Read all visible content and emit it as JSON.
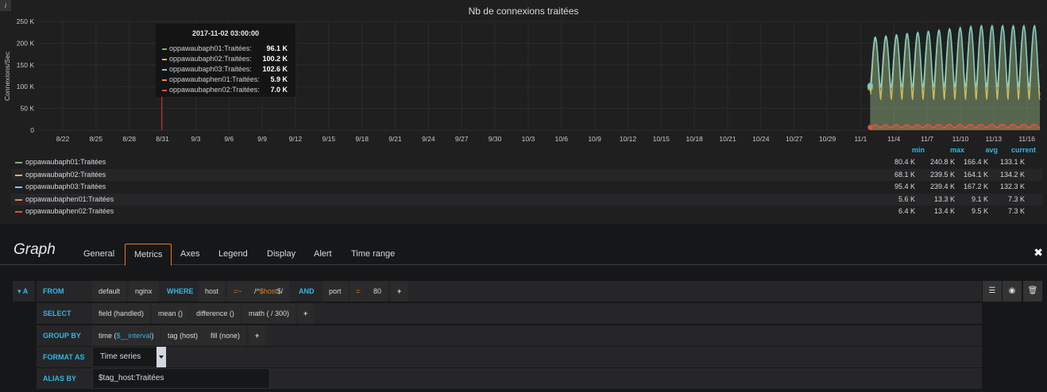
{
  "panel": {
    "info_icon": "i",
    "title": "Nb de connexions traitées"
  },
  "tooltip": {
    "time": "2017-11-02 03:00:00",
    "rows": [
      {
        "name": "oppawaubaph01:Traitées:",
        "value": "96.1 K",
        "color": "#7eb26d"
      },
      {
        "name": "oppawaubaph02:Traitées:",
        "value": "100.2 K",
        "color": "#eab839"
      },
      {
        "name": "oppawaubaph03:Traitées:",
        "value": "102.6 K",
        "color": "#6ed0e0"
      },
      {
        "name": "oppawaubaphen01:Traitées:",
        "value": "5.9 K",
        "color": "#ef843c"
      },
      {
        "name": "oppawaubaphen02:Traitées:",
        "value": "7.0 K",
        "color": "#e24d42"
      }
    ]
  },
  "legend": {
    "headers": [
      "min",
      "max",
      "avg",
      "current"
    ],
    "rows": [
      {
        "name": "oppawaubaph01:Traitées",
        "color": "#7eb26d",
        "min": "80.4 K",
        "max": "240.8 K",
        "avg": "166.4 K",
        "current": "133.1 K"
      },
      {
        "name": "oppawaubaph02:Traitées",
        "color": "#eab839",
        "min": "68.1 K",
        "max": "239.5 K",
        "avg": "164.1 K",
        "current": "134.2 K"
      },
      {
        "name": "oppawaubaph03:Traitées",
        "color": "#6ed0e0",
        "min": "95.4 K",
        "max": "239.4 K",
        "avg": "167.2 K",
        "current": "132.3 K"
      },
      {
        "name": "oppawaubaphen01:Traitées",
        "color": "#ef843c",
        "min": "5.6 K",
        "max": "13.3 K",
        "avg": "9.1 K",
        "current": "7.3 K"
      },
      {
        "name": "oppawaubaphen02:Traitées",
        "color": "#e24d42",
        "min": "6.4 K",
        "max": "13.4 K",
        "avg": "9.5 K",
        "current": "7.3 K"
      }
    ]
  },
  "chart_data": {
    "type": "area",
    "ylabel": "Connexions/Sec",
    "ylim": [
      0,
      250000
    ],
    "y_ticks": [
      "0",
      "50 K",
      "100 K",
      "150 K",
      "200 K",
      "250 K"
    ],
    "x_ticks": [
      "8/22",
      "8/25",
      "8/28",
      "8/31",
      "9/3",
      "9/6",
      "9/9",
      "9/12",
      "9/15",
      "9/18",
      "9/21",
      "9/24",
      "9/27",
      "9/30",
      "10/3",
      "10/6",
      "10/9",
      "10/12",
      "10/15",
      "10/18",
      "10/21",
      "10/24",
      "10/27",
      "10/29",
      "11/1",
      "11/4",
      "11/7",
      "11/10",
      "11/13",
      "11/16"
    ],
    "grid": true,
    "hover_marker_date": "8/31",
    "data_start_date": "11/1",
    "series": [
      {
        "name": "oppawaubaph01:Traitées",
        "color": "#7eb26d",
        "low": 80400,
        "high": 240800,
        "start": 96100
      },
      {
        "name": "oppawaubaph02:Traitées",
        "color": "#eab839",
        "low": 68100,
        "high": 239500,
        "start": 100200
      },
      {
        "name": "oppawaubaph03:Traitées",
        "color": "#6ed0e0",
        "low": 95400,
        "high": 239400,
        "start": 102600
      },
      {
        "name": "oppawaubaphen01:Traitées",
        "color": "#ef843c",
        "low": 5600,
        "high": 13300,
        "start": 5900
      },
      {
        "name": "oppawaubaphen02:Traitées",
        "color": "#e24d42",
        "low": 6400,
        "high": 13400,
        "start": 7000
      }
    ]
  },
  "editor": {
    "title": "Graph",
    "tabs": [
      "General",
      "Metrics",
      "Axes",
      "Legend",
      "Display",
      "Alert",
      "Time range"
    ],
    "active_tab": "Metrics",
    "close_label": "✖"
  },
  "query": {
    "ref": "A",
    "from": {
      "keyword": "FROM",
      "policy": "default",
      "measurement": "nginx",
      "where": "WHERE",
      "tag1": "host",
      "op1": "=~",
      "val1_pre": "/^",
      "val1_var": "$host",
      "val1_post": "$/",
      "and": "AND",
      "tag2": "port",
      "op2": "=",
      "val2": "80",
      "plus": "+"
    },
    "select": {
      "keyword": "SELECT",
      "parts": [
        "field (handled)",
        "mean ()",
        "difference ()",
        "math ( / 300)"
      ],
      "plus": "+"
    },
    "group_by": {
      "keyword": "GROUP BY",
      "time_pre": "time (",
      "time_var": "$__interval",
      "time_post": ")",
      "tag": "tag (host)",
      "fill": "fill (none)",
      "plus": "+"
    },
    "format_as": {
      "keyword": "FORMAT AS",
      "value": "Time series"
    },
    "alias_by": {
      "keyword": "ALIAS BY",
      "value": "$tag_host:Traitées"
    }
  }
}
